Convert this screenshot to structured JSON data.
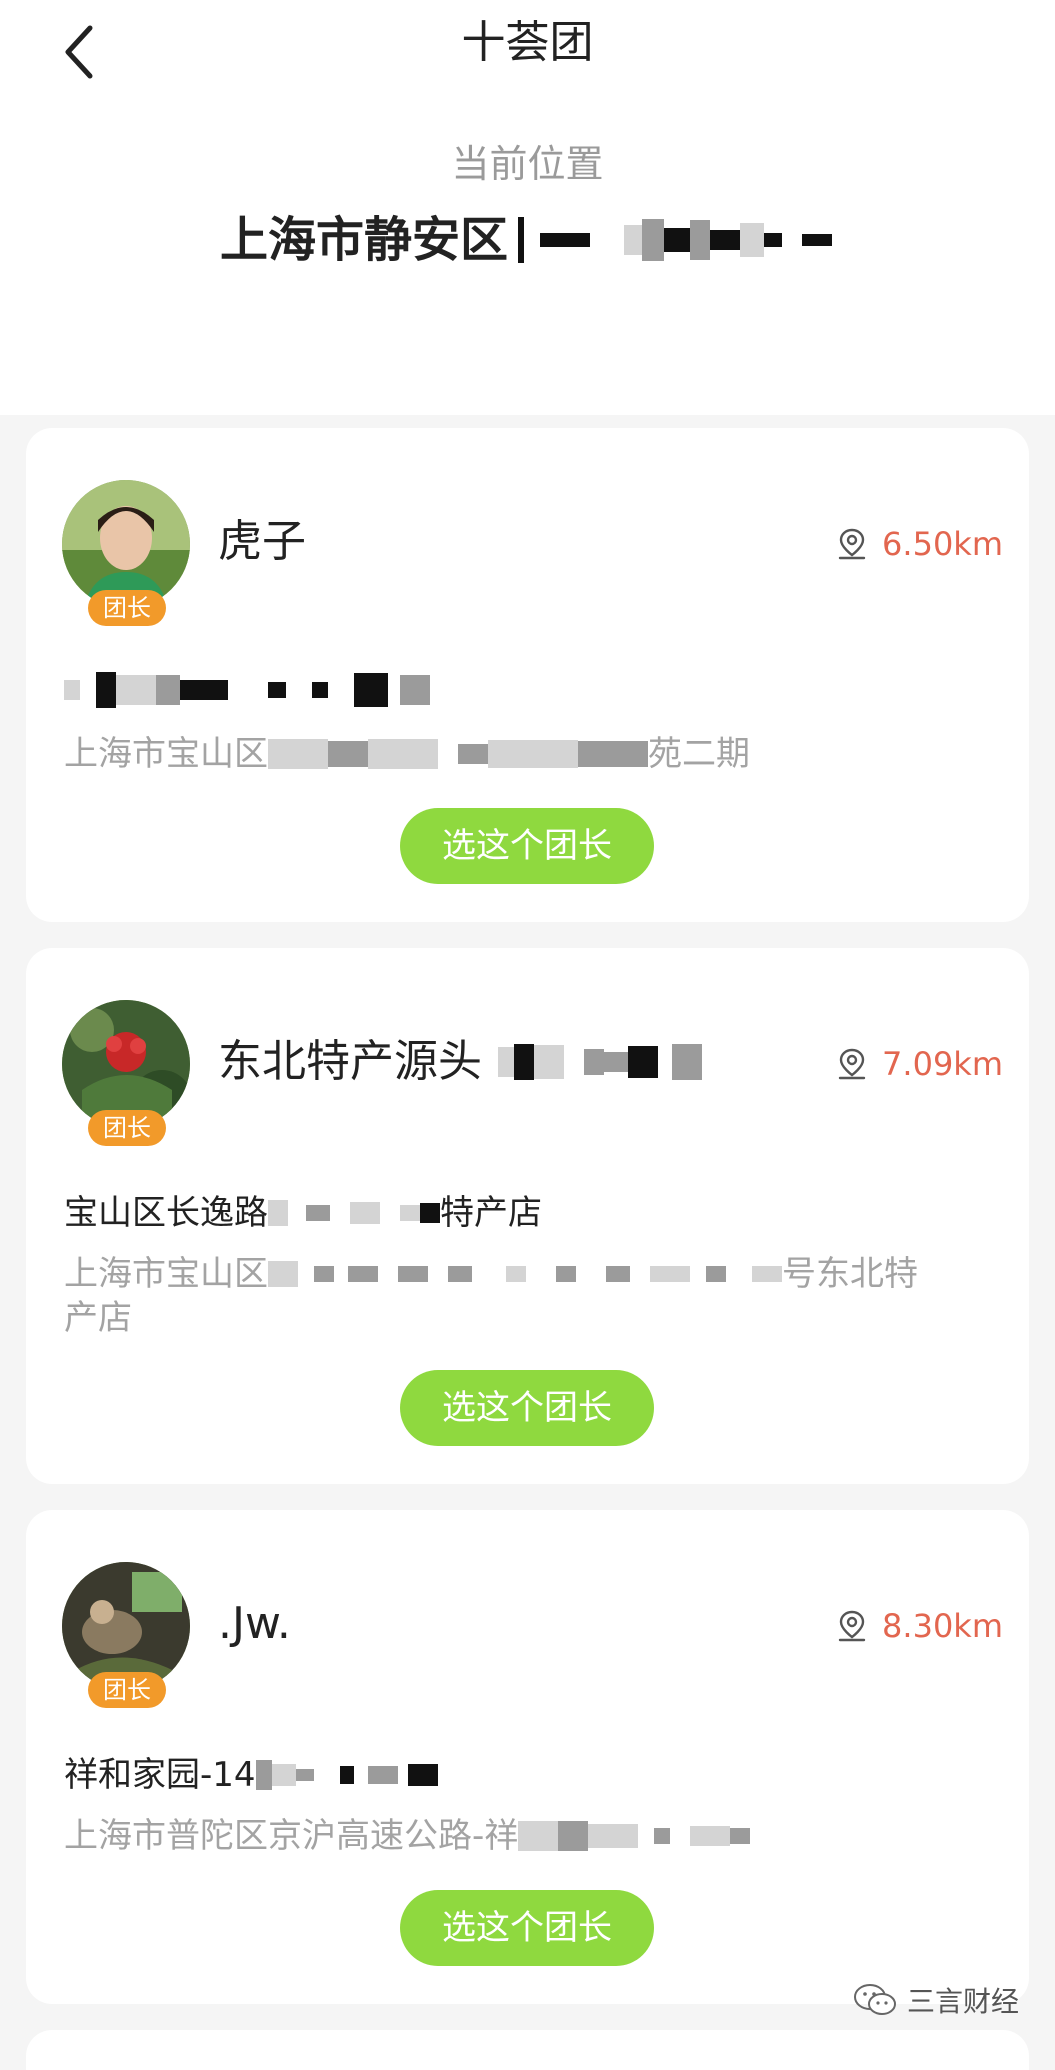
{
  "header": {
    "title": "十荟团",
    "back_icon": "chevron-left-icon",
    "location_caption": "当前位置",
    "location_value": "上海市静安区"
  },
  "leaders": [
    {
      "name": "虎子",
      "badge": "团长",
      "distance": "6.50km",
      "address_title": "",
      "address_detail": "上海市宝山区",
      "address_detail_tail": "苑二期",
      "button": "选这个团长"
    },
    {
      "name": "东北特产源头",
      "badge": "团长",
      "distance": "7.09km",
      "address_title": "宝山区长逸路",
      "address_title_tail": "特产店",
      "address_detail": "上海市宝山区",
      "address_detail_tail": "号东北特",
      "address_detail_line2": "产店",
      "button": "选这个团长"
    },
    {
      "name": ".Jw.",
      "badge": "团长",
      "distance": "8.30km",
      "address_title": "祥和家园-14",
      "address_detail": "上海市普陀区京沪高速公路-祥",
      "button": "选这个团长"
    }
  ],
  "watermark": {
    "text": "三言财经",
    "icon": "wechat-icon"
  },
  "colors": {
    "accent_green": "#8fd93f",
    "distance_red": "#e2664f",
    "badge_orange": "#f29a2a"
  }
}
